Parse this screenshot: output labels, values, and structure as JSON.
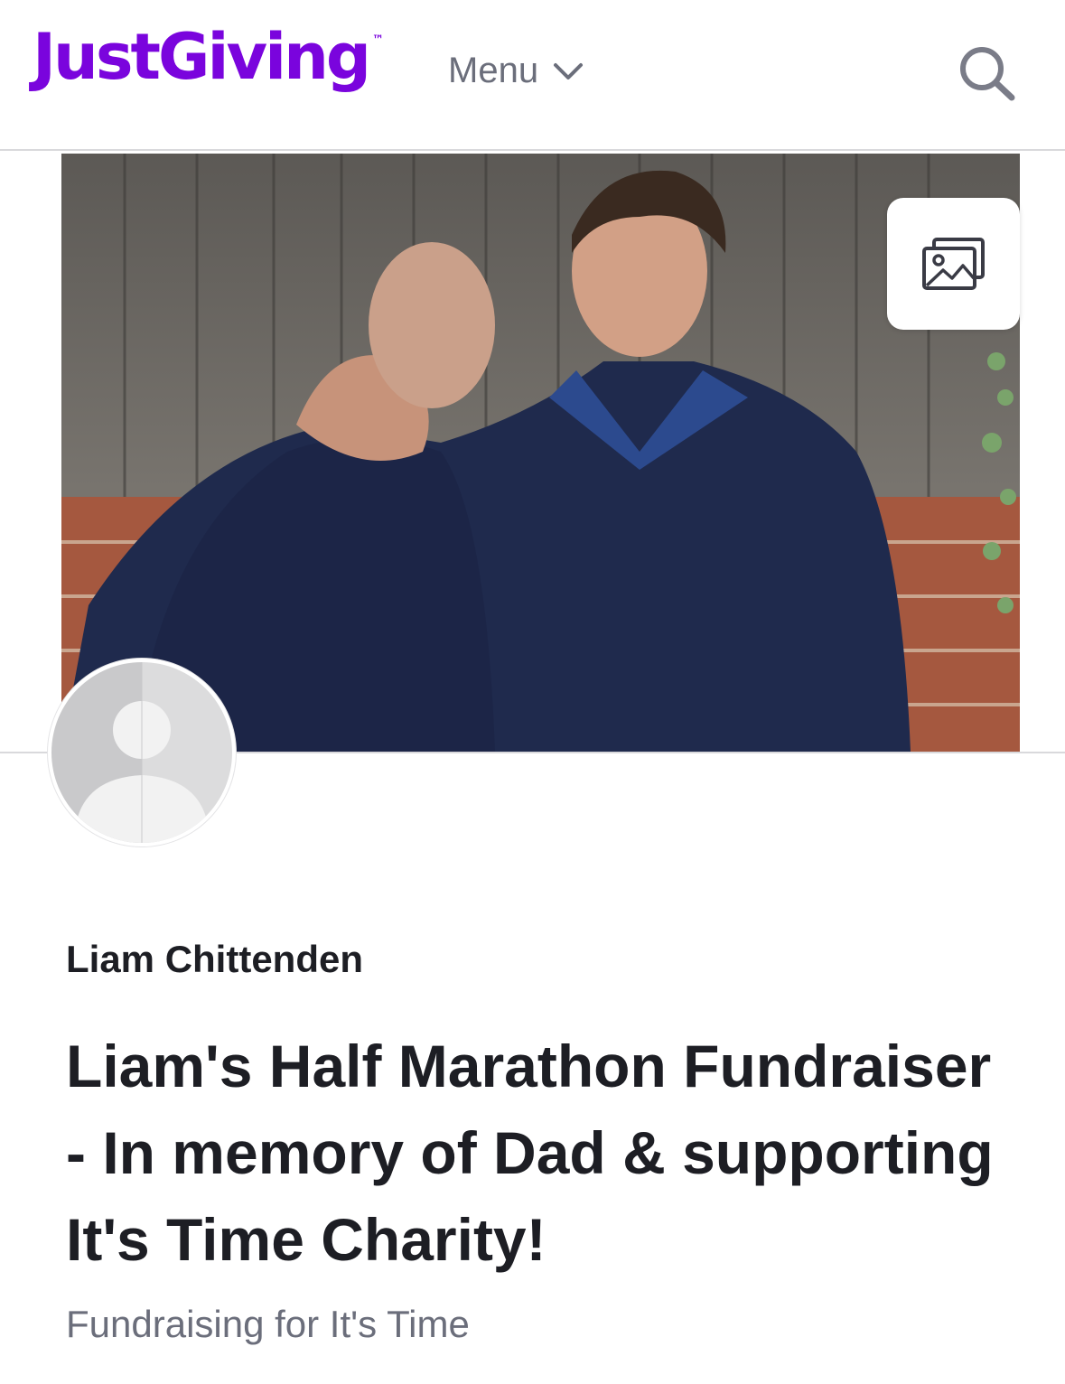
{
  "header": {
    "logo_text": "JustGiving",
    "logo_tm": "™",
    "menu_label": "Menu",
    "search_icon": "search-icon"
  },
  "cover": {
    "image_description_icon": "photo",
    "gallery_icon": "image-gallery-icon"
  },
  "avatar": {
    "icon": "default-user-avatar-icon"
  },
  "page": {
    "owner_name": "Liam Chittenden",
    "title": "Liam's Half Marathon Fundraiser - In memory of Dad & supporting It's Time Charity!",
    "subtitle": "Fundraising for It's Time"
  },
  "colors": {
    "brand": "#7a04dd",
    "text_primary": "#1d1e24",
    "text_secondary": "#6b6e7b",
    "divider": "#d9d9dc"
  }
}
